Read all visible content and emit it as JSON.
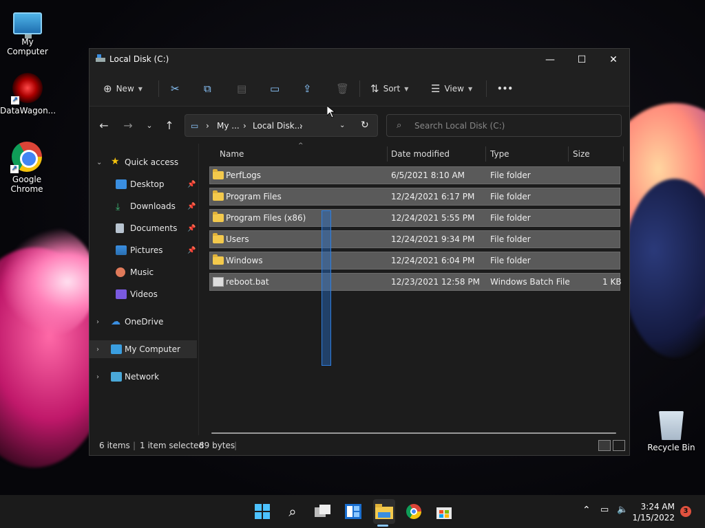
{
  "colors": {
    "accent": "#8cc8ff",
    "selected_row": "#5a5a5a",
    "folder": "#f3c94c",
    "window_bg": "#1c1c1c",
    "taskbar": "#1b1b1b"
  },
  "desktop": {
    "icons": [
      {
        "label": "My Computer",
        "icon": "monitor-icon"
      },
      {
        "label": "DataWagon...",
        "icon": "datawagon-icon"
      },
      {
        "label": "Google Chrome",
        "icon": "chrome-icon"
      }
    ],
    "recycle_bin": {
      "label": "Recycle Bin",
      "icon": "recycle-bin-icon"
    }
  },
  "window": {
    "title": "Local Disk (C:)",
    "toolbar": {
      "new_label": "New",
      "sort_label": "Sort",
      "view_label": "View",
      "more_label": "•••"
    },
    "address": {
      "crumbs": [
        "My ...",
        "Local Disk..."
      ]
    },
    "search": {
      "placeholder": "Search Local Disk (C:)"
    },
    "sidebar": {
      "quick_access": "Quick access",
      "items": [
        {
          "label": "Desktop",
          "pinned": true
        },
        {
          "label": "Downloads",
          "pinned": true
        },
        {
          "label": "Documents",
          "pinned": true
        },
        {
          "label": "Pictures",
          "pinned": true
        },
        {
          "label": "Music",
          "pinned": false
        },
        {
          "label": "Videos",
          "pinned": false
        }
      ],
      "onedrive": "OneDrive",
      "my_computer": "My Computer",
      "network": "Network"
    },
    "columns": {
      "name": "Name",
      "date": "Date modified",
      "type": "Type",
      "size": "Size"
    },
    "files": [
      {
        "name": "PerfLogs",
        "date": "6/5/2021 8:10 AM",
        "type": "File folder",
        "size": "",
        "icon": "folder-icon"
      },
      {
        "name": "Program Files",
        "date": "12/24/2021 6:17 PM",
        "type": "File folder",
        "size": "",
        "icon": "folder-icon"
      },
      {
        "name": "Program Files (x86)",
        "date": "12/24/2021 5:55 PM",
        "type": "File folder",
        "size": "",
        "icon": "folder-icon"
      },
      {
        "name": "Users",
        "date": "12/24/2021 9:34 PM",
        "type": "File folder",
        "size": "",
        "icon": "folder-icon"
      },
      {
        "name": "Windows",
        "date": "12/24/2021 6:04 PM",
        "type": "File folder",
        "size": "",
        "icon": "folder-icon"
      },
      {
        "name": "reboot.bat",
        "date": "12/23/2021 12:58 PM",
        "type": "Windows Batch File",
        "size": "1 KB",
        "icon": "batch-file-icon"
      }
    ],
    "status": {
      "items": "6 items",
      "selected": "1 item selected",
      "bytes": "89 bytes"
    }
  },
  "taskbar": {
    "clock_time": "3:24 AM",
    "clock_date": "1/15/2022",
    "notification_count": "3"
  }
}
